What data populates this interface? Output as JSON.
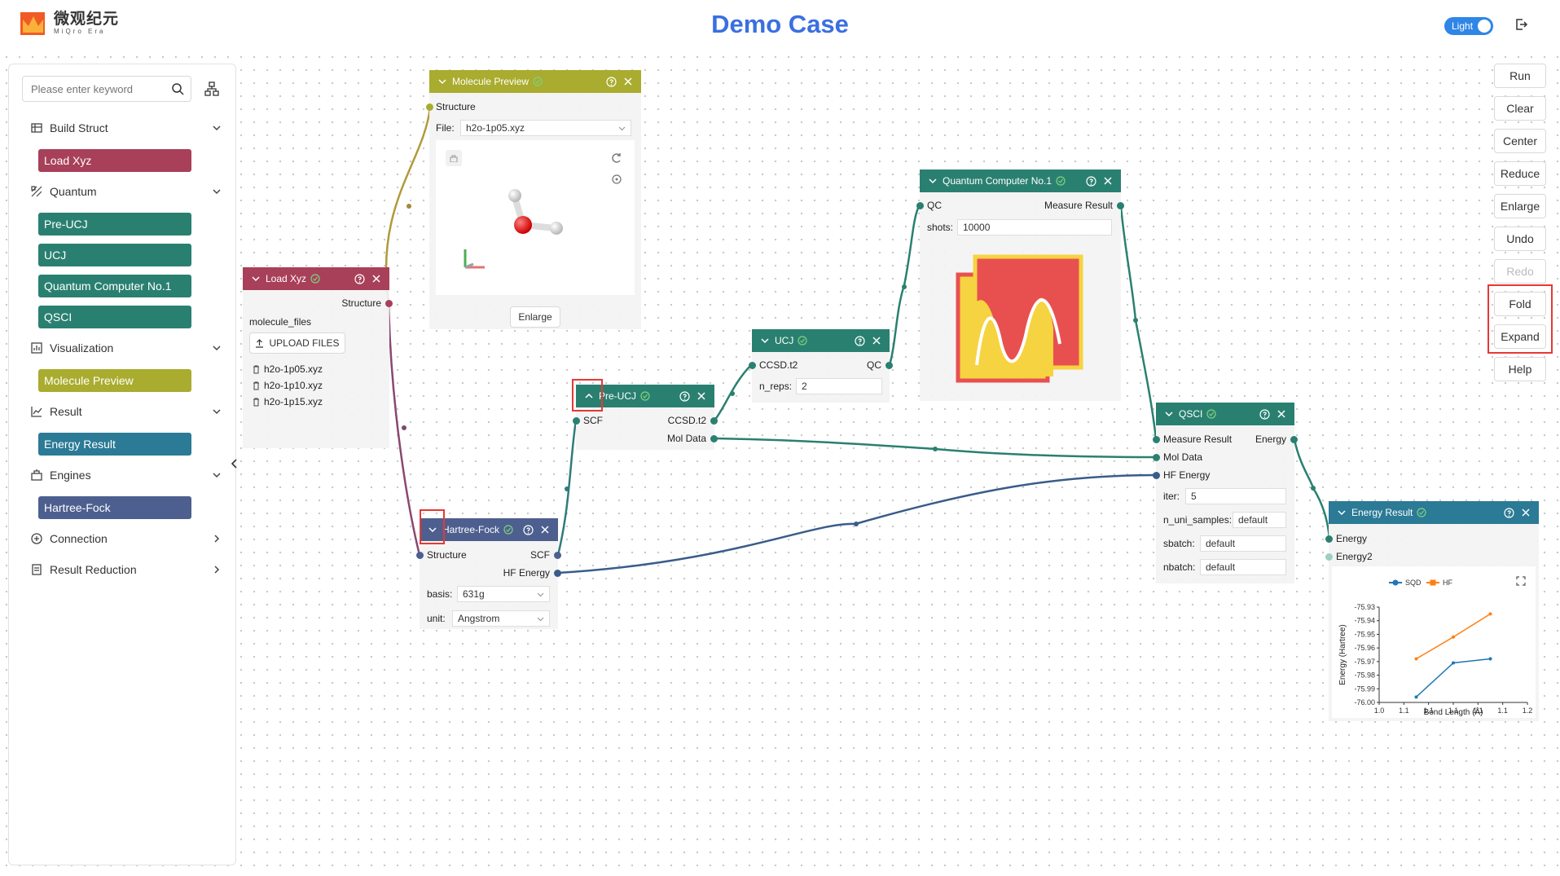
{
  "header": {
    "logo_main": "微观纪元",
    "logo_sub": "MiQro Era",
    "title": "Demo Case",
    "theme_label": "Light"
  },
  "sidebar": {
    "search_placeholder": "Please enter keyword",
    "categories": [
      {
        "label": "Build Struct",
        "items": [
          "Load Xyz"
        ]
      },
      {
        "label": "Quantum",
        "items": [
          "Pre-UCJ",
          "UCJ",
          "Quantum Computer No.1",
          "QSCI"
        ]
      },
      {
        "label": "Visualization",
        "items": [
          "Molecule Preview"
        ]
      },
      {
        "label": "Result",
        "items": [
          "Energy Result"
        ]
      },
      {
        "label": "Engines",
        "items": [
          "Hartree-Fock"
        ]
      },
      {
        "label": "Connection",
        "items": []
      },
      {
        "label": "Result Reduction",
        "items": []
      }
    ]
  },
  "toolbar": [
    "Run",
    "Clear",
    "Center",
    "Reduce",
    "Enlarge",
    "Undo",
    "Redo",
    "Fold",
    "Expand",
    "Help"
  ],
  "colors": {
    "load_xyz": "#a8405a",
    "quantum": "#2a8070",
    "visualization": "#a9ac2e",
    "result": "#2b7a96",
    "engine": "#4d5f8f",
    "highlight": "#e53935"
  },
  "nodes": {
    "molecule_preview": {
      "title": "Molecule Preview",
      "input": "Structure",
      "file_label": "File:",
      "file_value": "h2o-1p05.xyz",
      "enlarge_label": "Enlarge"
    },
    "load_xyz": {
      "title": "Load Xyz",
      "output": "Structure",
      "files_label": "molecule_files",
      "upload_label": "UPLOAD FILES",
      "files": [
        "h2o-1p05.xyz",
        "h2o-1p10.xyz",
        "h2o-1p15.xyz"
      ]
    },
    "quantum_computer": {
      "title": "Quantum Computer No.1",
      "input": "QC",
      "output": "Measure Result",
      "shots_label": "shots:",
      "shots_value": "10000"
    },
    "ucj": {
      "title": "UCJ",
      "input": "CCSD.t2",
      "output": "QC",
      "nreps_label": "n_reps:",
      "nreps_value": "2"
    },
    "pre_ucj": {
      "title": "Pre-UCJ",
      "input": "SCF",
      "output1": "CCSD.t2",
      "output2": "Mol Data"
    },
    "qsci": {
      "title": "QSCI",
      "input1": "Measure Result",
      "input2": "Mol Data",
      "input3": "HF Energy",
      "output": "Energy",
      "params": [
        {
          "label": "iter:",
          "value": "5"
        },
        {
          "label": "n_uni_samples:",
          "value": "default"
        },
        {
          "label": "sbatch:",
          "value": "default"
        },
        {
          "label": "nbatch:",
          "value": "default"
        }
      ]
    },
    "hartree_fock": {
      "title": "Hartree-Fock",
      "input": "Structure",
      "output1": "SCF",
      "output2": "HF Energy",
      "basis_label": "basis:",
      "basis_value": "631g",
      "unit_label": "unit:",
      "unit_value": "Angstrom"
    },
    "energy_result": {
      "title": "Energy Result",
      "input1": "Energy",
      "input2": "Energy2"
    }
  },
  "chart_data": {
    "type": "line",
    "x": [
      1.05,
      1.1,
      1.15
    ],
    "series": [
      {
        "name": "SQD",
        "values": [
          -75.996,
          -75.971,
          -75.968
        ],
        "color": "#1f77b4"
      },
      {
        "name": "HF",
        "values": [
          -75.968,
          -75.952,
          -75.935
        ],
        "color": "#ff7f0e"
      }
    ],
    "xticks": [
      "1.0",
      "1.1",
      "1.1",
      "1.1",
      "1.1",
      "1.1",
      "1.2"
    ],
    "yticks": [
      "-75.93",
      "-75.94",
      "-75.95",
      "-75.96",
      "-75.97",
      "-75.98",
      "-75.99",
      "-76.00"
    ],
    "xlabel": "Bond Length (Å)",
    "ylabel": "Energy (Hartree)",
    "xlim": [
      1.0,
      1.2
    ],
    "ylim": [
      -76.0,
      -75.93
    ],
    "legend": "top-left",
    "grid": false
  }
}
